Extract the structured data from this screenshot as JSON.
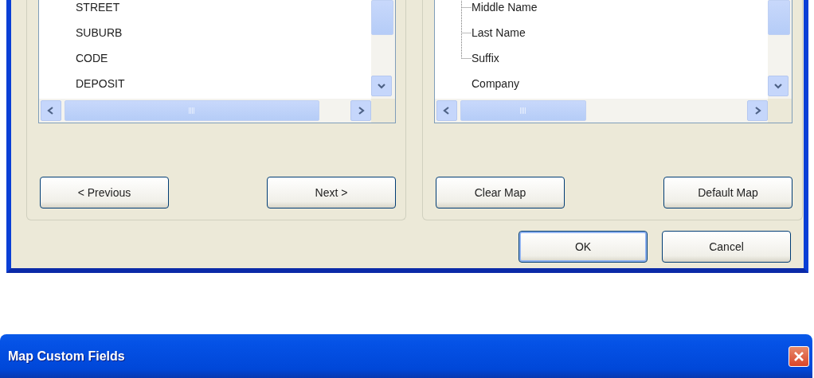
{
  "mapping_window": {
    "left_panel": {
      "list": {
        "items": [
          {
            "label": "STREET"
          },
          {
            "label": "SUBURB"
          },
          {
            "label": "CODE"
          },
          {
            "label": "DEPOSIT"
          }
        ]
      },
      "buttons": [
        "< Previous",
        "Next >"
      ]
    },
    "right_panel": {
      "tree": {
        "items": [
          {
            "children": [
              {
                "label": "Middle Name"
              },
              {
                "label": "Last Name"
              },
              {
                "label": "Suffix"
              }
            ]
          },
          {
            "label": "Company"
          }
        ]
      },
      "buttons": [
        "Clear Map",
        "Default Map"
      ]
    },
    "dialog_buttons": [
      {
        "label": "OK",
        "default": true
      },
      {
        "label": "Cancel",
        "default": false
      }
    ]
  },
  "second_window": {
    "title": "Map Custom Fields"
  }
}
